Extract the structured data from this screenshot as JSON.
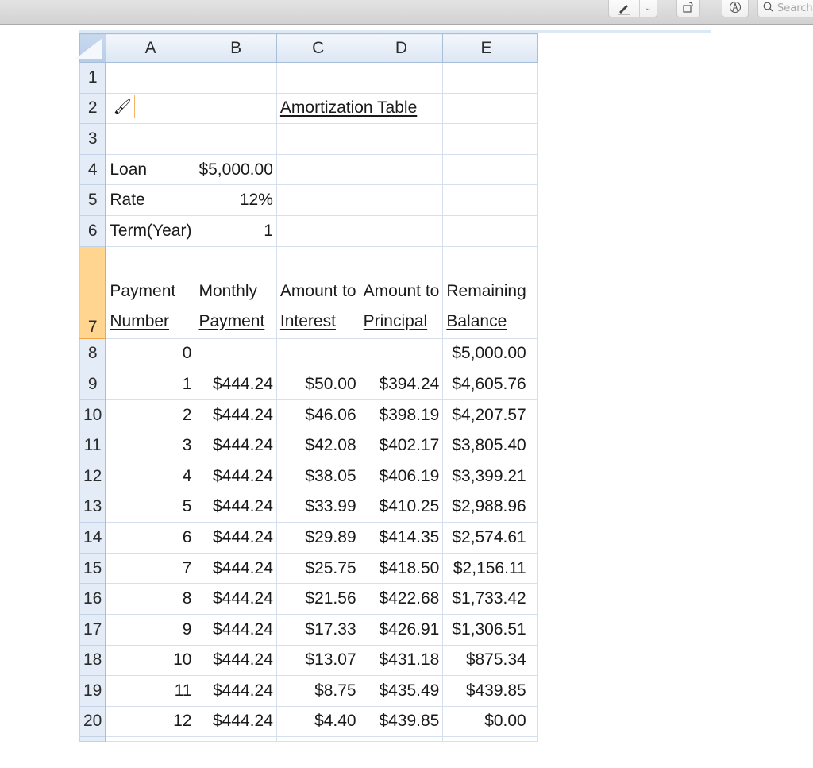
{
  "toolbar": {
    "markup_icon": "pen-markup-icon",
    "markup_dropdown_glyph": "⌄",
    "rotate_icon": "rotate-icon",
    "annotate_icon": "markup-circle-icon",
    "search_placeholder": "Search"
  },
  "sheet": {
    "columns": [
      "A",
      "B",
      "C",
      "D",
      "E"
    ],
    "title": "Amortization Table",
    "inputs": [
      {
        "row": "4",
        "label": "Loan",
        "value": "$5,000.00"
      },
      {
        "row": "5",
        "label": "Rate",
        "value": "12%"
      },
      {
        "row": "6",
        "label": "Term(Year)",
        "value": "1"
      }
    ],
    "blank_rows": [
      "1",
      "3"
    ],
    "title_row": "2",
    "header_row": "7",
    "headers": [
      {
        "line1": "Payment",
        "line2": "Number"
      },
      {
        "line1": "Monthly",
        "line2": "Payment"
      },
      {
        "line1": "Amount to",
        "line2": "Interest"
      },
      {
        "line1": "Amount to",
        "line2": "Principal"
      },
      {
        "line1": "Remaining",
        "line2": "Balance"
      }
    ],
    "rows": [
      {
        "row": "8",
        "n": "0",
        "payment": "",
        "interest": "",
        "principal": "",
        "balance": "$5,000.00"
      },
      {
        "row": "9",
        "n": "1",
        "payment": "$444.24",
        "interest": "$50.00",
        "principal": "$394.24",
        "balance": "$4,605.76"
      },
      {
        "row": "10",
        "n": "2",
        "payment": "$444.24",
        "interest": "$46.06",
        "principal": "$398.19",
        "balance": "$4,207.57"
      },
      {
        "row": "11",
        "n": "3",
        "payment": "$444.24",
        "interest": "$42.08",
        "principal": "$402.17",
        "balance": "$3,805.40"
      },
      {
        "row": "12",
        "n": "4",
        "payment": "$444.24",
        "interest": "$38.05",
        "principal": "$406.19",
        "balance": "$3,399.21"
      },
      {
        "row": "13",
        "n": "5",
        "payment": "$444.24",
        "interest": "$33.99",
        "principal": "$410.25",
        "balance": "$2,988.96"
      },
      {
        "row": "14",
        "n": "6",
        "payment": "$444.24",
        "interest": "$29.89",
        "principal": "$414.35",
        "balance": "$2,574.61"
      },
      {
        "row": "15",
        "n": "7",
        "payment": "$444.24",
        "interest": "$25.75",
        "principal": "$418.50",
        "balance": "$2,156.11"
      },
      {
        "row": "16",
        "n": "8",
        "payment": "$444.24",
        "interest": "$21.56",
        "principal": "$422.68",
        "balance": "$1,733.42"
      },
      {
        "row": "17",
        "n": "9",
        "payment": "$444.24",
        "interest": "$17.33",
        "principal": "$426.91",
        "balance": "$1,306.51"
      },
      {
        "row": "18",
        "n": "10",
        "payment": "$444.24",
        "interest": "$13.07",
        "principal": "$431.18",
        "balance": "$875.34"
      },
      {
        "row": "19",
        "n": "11",
        "payment": "$444.24",
        "interest": "$8.75",
        "principal": "$435.49",
        "balance": "$439.85"
      },
      {
        "row": "20",
        "n": "12",
        "payment": "$444.24",
        "interest": "$4.40",
        "principal": "$439.85",
        "balance": "$0.00"
      }
    ],
    "paste_options_icon": "paintbrush-format-icon",
    "selected_row_color": "#ffd58f",
    "header_bg_color": "#dce6f3"
  }
}
